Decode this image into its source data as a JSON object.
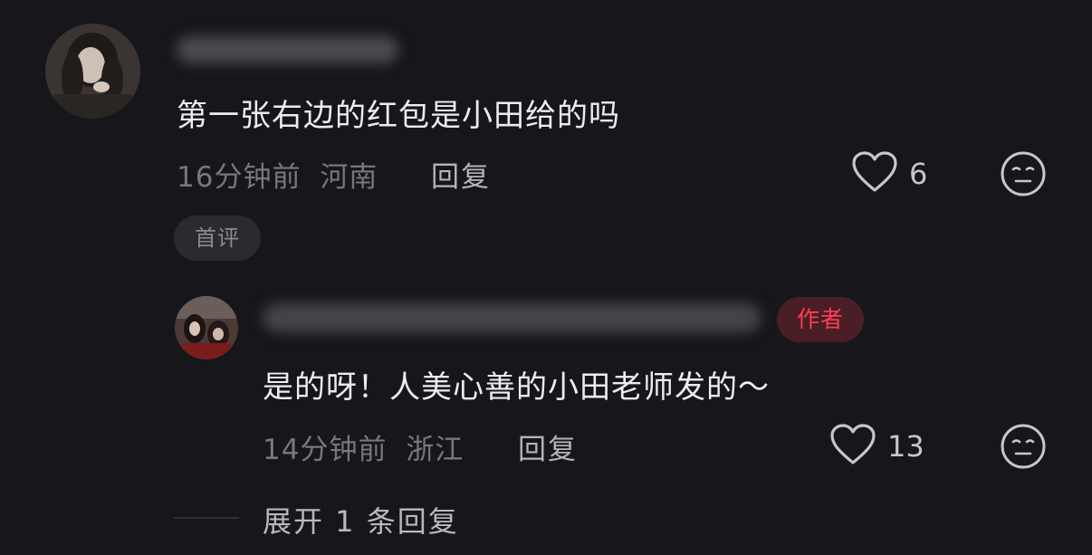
{
  "comments": [
    {
      "text": "第一张右边的红包是小田给的吗",
      "time": "16分钟前",
      "location": "河南",
      "reply_label": "回复",
      "likes": "6",
      "badge": "首评"
    },
    {
      "text": "是的呀！人美心善的小田老师发的～",
      "time": "14分钟前",
      "location": "浙江",
      "reply_label": "回复",
      "likes": "13",
      "badge": "作者"
    }
  ],
  "expand_label": "展开 1 条回复",
  "icons": {
    "like": "heart-outline-icon",
    "emoji": "emoji-face-icon"
  },
  "colors": {
    "background": "#17161b",
    "author_badge_text": "#ff3d57",
    "author_badge_bg": "#4a1e25",
    "meta_text": "#77777d"
  }
}
